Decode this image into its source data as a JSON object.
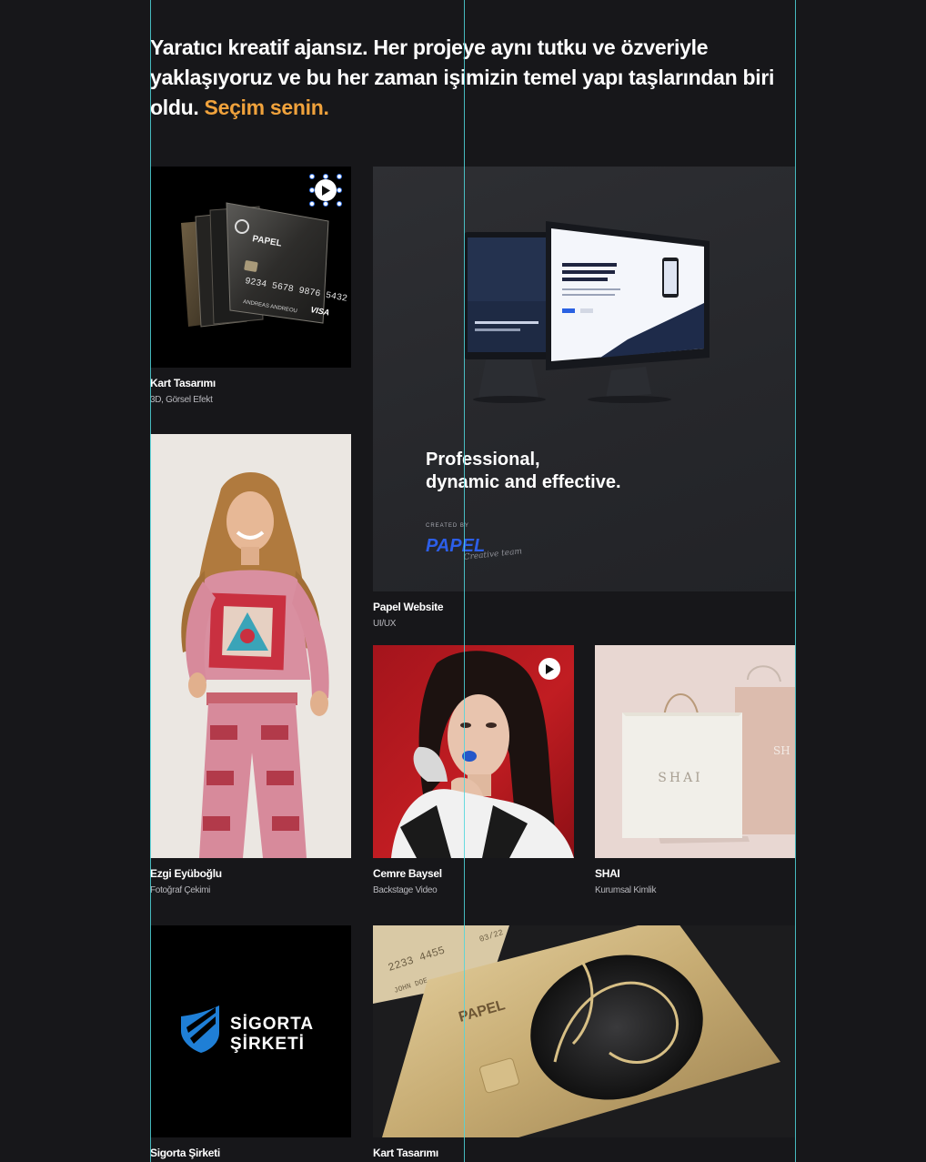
{
  "intro": {
    "text": "Yaratıcı kreatif ajansız. Her projeye aynı tutku ve özveriyle yaklaşıyoruz ve bu her zaman işimizin temel yapı taşlarından biri oldu.",
    "accent": "Seçim senin."
  },
  "colors": {
    "background": "#17171a",
    "accent": "#f0a23c",
    "guide": "#4fd6dc"
  },
  "projects": [
    {
      "title": "Kart Tasarımı",
      "subtitle": "3D, Görsel Efekt",
      "icon": "play-icon"
    },
    {
      "title": "Papel Website",
      "subtitle": "UI/UX"
    },
    {
      "title": "Ezgi Eyüboğlu",
      "subtitle": "Fotoğraf Çekimi"
    },
    {
      "title": "Cemre Baysel",
      "subtitle": "Backstage Video",
      "icon": "play-icon"
    },
    {
      "title": "SHAI",
      "subtitle": "Kurumsal Kimlik"
    },
    {
      "title": "Sigorta Şirketi",
      "subtitle": ""
    },
    {
      "title": "Kart Tasarımı",
      "subtitle": ""
    }
  ],
  "images": {
    "card": {
      "brand": "PAPEL",
      "number": "9234 5678 9876 5432",
      "holder": "ANDREAS ANDREOU",
      "network": "VISA"
    },
    "website": {
      "headline_1": "Professional,",
      "headline_2": "dynamic and effective.",
      "created_by": "CREATED BY",
      "logo": "PAPEL",
      "signature": "Creative team"
    },
    "shai": {
      "logo": "SHAI"
    },
    "sigorta": {
      "line_1": "SİGORTA",
      "line_2": "ŞİRKETİ"
    },
    "gold_card": {
      "number": "2233 4455",
      "expiry": "03/22",
      "holder": "JOHN DOE",
      "brand": "PAPEL"
    }
  }
}
